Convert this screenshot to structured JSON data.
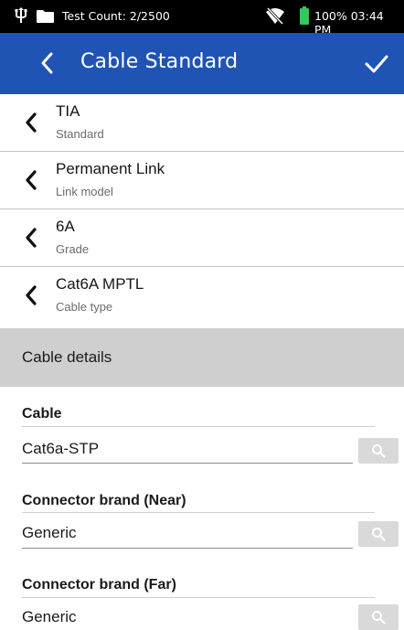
{
  "status_bar": {
    "test_count": "Test Count: 2/2500",
    "battery": "100% 03:44 PM"
  },
  "app_bar": {
    "title": "Cable Standard"
  },
  "rows": [
    {
      "primary": "TIA",
      "secondary": "Standard"
    },
    {
      "primary": "Permanent Link",
      "secondary": "Link model"
    },
    {
      "primary": "6A",
      "secondary": "Grade"
    },
    {
      "primary": "Cat6A MPTL",
      "secondary": "Cable type"
    }
  ],
  "section": {
    "title": "Cable details"
  },
  "fields": [
    {
      "label": "Cable",
      "value": "Cat6a-STP"
    },
    {
      "label": "Connector brand (Near)",
      "value": "Generic"
    },
    {
      "label": "Connector brand (Far)",
      "value": "Generic"
    }
  ],
  "colors": {
    "app_bar": "#1f54b4",
    "battery": "#34c759",
    "section_header": "#cfcfcf",
    "search_button": "#d9d9d9"
  }
}
